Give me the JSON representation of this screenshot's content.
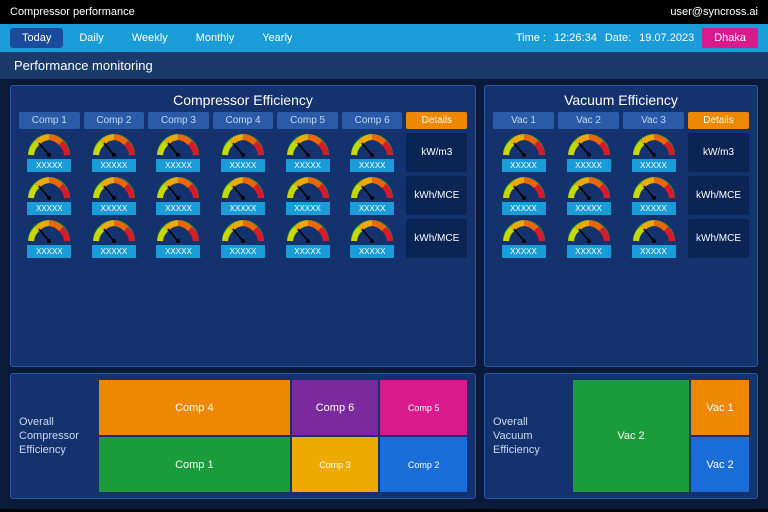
{
  "header": {
    "title": "Compressor performance",
    "user": "user@syncross.ai"
  },
  "nav": {
    "items": [
      "Today",
      "Daily",
      "Weekly",
      "Monthly",
      "Yearly"
    ],
    "active": 0,
    "time_lbl": "Time :",
    "time": "12:26:34",
    "date_lbl": "Date:",
    "date": "19.07.2023",
    "location": "Dhaka"
  },
  "subtitle": "Performance monitoring",
  "comp": {
    "title": "Compressor Efficiency",
    "tabs": [
      "Comp 1",
      "Comp 2",
      "Comp 3",
      "Comp 4",
      "Comp 5",
      "Comp 6"
    ],
    "details": "Details",
    "units": [
      "kW/m3",
      "kWh/MCE",
      "kWh/MCE"
    ],
    "val": "XXXXX"
  },
  "vac": {
    "title": "Vacuum Efficiency",
    "tabs": [
      "Vac 1",
      "Vac 2",
      "Vac 3"
    ],
    "details": "Details",
    "units": [
      "kW/m3",
      "kWh/MCE",
      "kWh/MCE"
    ],
    "val": "XXXXX"
  },
  "tmcomp": {
    "label": "Overall Compressor Efficiency",
    "boxes": [
      "Comp 4",
      "Comp 6",
      "Comp 5",
      "Comp 1",
      "Comp 3",
      "Comp 2"
    ]
  },
  "tmvac": {
    "label": "Overall Vacuum Efficiency",
    "boxes": [
      "Vac 1",
      "Vac 2",
      "Vac 2"
    ]
  }
}
